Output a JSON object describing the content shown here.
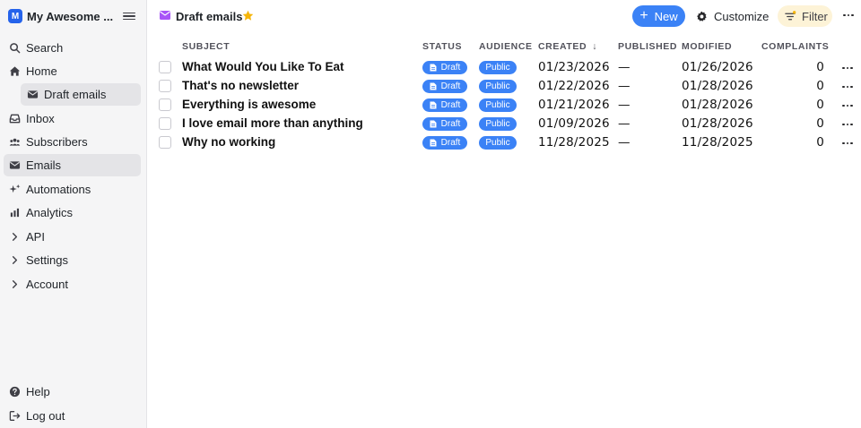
{
  "app": {
    "logo_letter": "M",
    "workspace_name": "My Awesome ..."
  },
  "sidebar": {
    "items": [
      {
        "label": "Search",
        "icon": "search-icon"
      },
      {
        "label": "Home",
        "icon": "home-icon"
      },
      {
        "label": "Draft emails",
        "icon": "envelope-icon"
      },
      {
        "label": "Inbox",
        "icon": "inbox-icon"
      },
      {
        "label": "Subscribers",
        "icon": "users-icon"
      },
      {
        "label": "Emails",
        "icon": "envelope-icon"
      },
      {
        "label": "Automations",
        "icon": "sparkle-icon"
      },
      {
        "label": "Analytics",
        "icon": "bar-chart-icon"
      },
      {
        "label": "API",
        "icon": "chevron-right-icon"
      },
      {
        "label": "Settings",
        "icon": "chevron-right-icon"
      },
      {
        "label": "Account",
        "icon": "chevron-right-icon"
      }
    ],
    "bottom": [
      {
        "label": "Help",
        "icon": "help-icon"
      },
      {
        "label": "Log out",
        "icon": "logout-icon"
      }
    ]
  },
  "header": {
    "title": "Draft emails",
    "new_label": "New",
    "customize_label": "Customize",
    "filter_label": "Filter"
  },
  "table": {
    "columns": [
      "SUBJECT",
      "STATUS",
      "AUDIENCE",
      "CREATED",
      "PUBLISHED",
      "MODIFIED",
      "COMPLAINTS"
    ],
    "sort_indicator": "↓",
    "rows": [
      {
        "subject": "What Would You Like To Eat",
        "status": "Draft",
        "audience": "Public",
        "created": "01/23/2026",
        "published": "—",
        "modified": "01/26/2026",
        "complaints": "0"
      },
      {
        "subject": "That's no newsletter",
        "status": "Draft",
        "audience": "Public",
        "created": "01/22/2026",
        "published": "—",
        "modified": "01/28/2026",
        "complaints": "0"
      },
      {
        "subject": "Everything is awesome",
        "status": "Draft",
        "audience": "Public",
        "created": "01/21/2026",
        "published": "—",
        "modified": "01/28/2026",
        "complaints": "0"
      },
      {
        "subject": "I love email more than anything",
        "status": "Draft",
        "audience": "Public",
        "created": "01/09/2026",
        "published": "—",
        "modified": "01/28/2026",
        "complaints": "0"
      },
      {
        "subject": "Why no working",
        "status": "Draft",
        "audience": "Public",
        "created": "11/28/2025",
        "published": "—",
        "modified": "11/28/2025",
        "complaints": "0"
      }
    ]
  },
  "colors": {
    "accent": "#3b82f6",
    "title_icon": "#a855f7",
    "star": "#f5b50a",
    "filter_bg": "#fdf3d7"
  }
}
